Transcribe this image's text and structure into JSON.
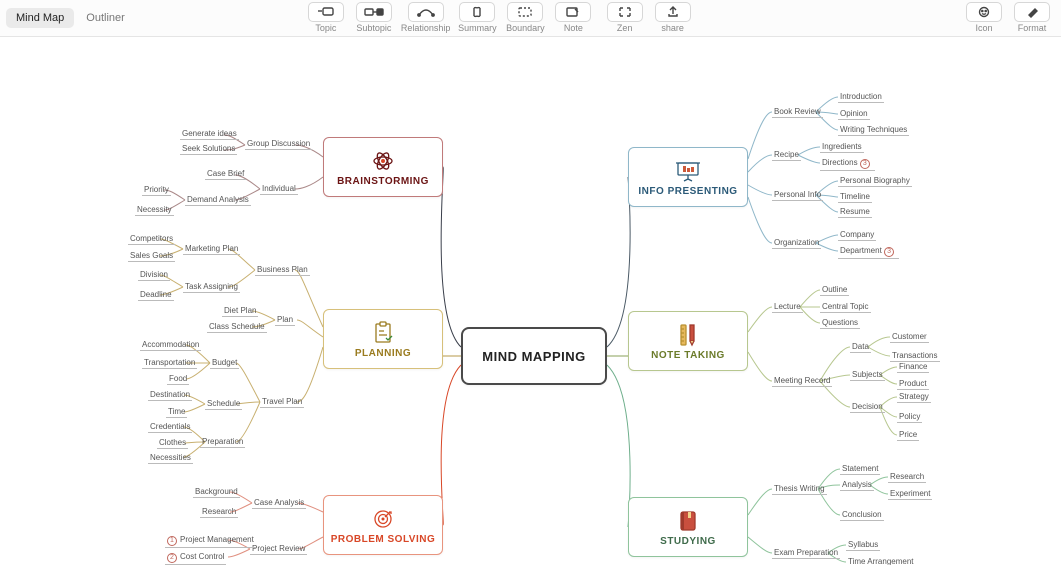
{
  "view_tabs": {
    "mindmap": "Mind Map",
    "outliner": "Outliner"
  },
  "tools": {
    "topic": "Topic",
    "subtopic": "Subtopic",
    "relationship": "Relationship",
    "summary": "Summary",
    "boundary": "Boundary",
    "note": "Note",
    "zen": "Zen",
    "share": "share",
    "icon": "Icon",
    "format": "Format"
  },
  "central": "MIND MAPPING",
  "mains": {
    "brain": "BRAINSTORMING",
    "plan": "PLANNING",
    "prob": "PROBLEM SOLVING",
    "info": "INFO PRESENTING",
    "note": "NOTE TAKING",
    "study": "STUDYING"
  },
  "leaves": {
    "group_disc": "Group Discussion",
    "gen_ideas": "Generate ideas",
    "seek_sol": "Seek Solutions",
    "individual": "Individual",
    "case_brief": "Case Brief",
    "demand": "Demand Analysis",
    "priority": "Priority",
    "necessity": "Necessity",
    "biz_plan": "Business Plan",
    "mkt_plan": "Marketing Plan",
    "competitors": "Competitors",
    "sales_goals": "Sales Goals",
    "task_asg": "Task Assigning",
    "division": "Division",
    "deadline": "Deadline",
    "plan": "Plan",
    "diet": "Diet Plan",
    "class": "Class Schedule",
    "travel": "Travel Plan",
    "budget": "Budget",
    "accom": "Accommodation",
    "transport": "Transportation",
    "food": "Food",
    "schedule": "Schedule",
    "dest": "Destination",
    "time": "Time",
    "prep": "Preparation",
    "cred": "Credentials",
    "clothes": "Clothes",
    "necess": "Necessities",
    "case_an": "Case Analysis",
    "background": "Background",
    "research": "Research",
    "proj_rev": "Project Review",
    "proj_mgmt": "Project Management",
    "cost": "Cost Control",
    "book_rev": "Book Review",
    "intro": "Introduction",
    "opinion": "Opinion",
    "writing": "Writing Techniques",
    "recipe": "Recipe",
    "ingr": "Ingredients",
    "dir": "Directions",
    "pinfo": "Personal Info",
    "pbio": "Personal Biography",
    "timeline": "Timeline",
    "resume": "Resume",
    "org": "Organization",
    "company": "Company",
    "dept": "Department",
    "lecture": "Lecture",
    "outline": "Outline",
    "ctopic": "Central Topic",
    "questions": "Questions",
    "mrec": "Meeting Record",
    "data": "Data",
    "customer": "Customer",
    "trans": "Transactions",
    "subjects": "Subjects",
    "finance": "Finance",
    "product": "Product",
    "decision": "Decision",
    "strategy": "Strategy",
    "policy": "Policy",
    "price": "Price",
    "thesis": "Thesis Writing",
    "statement": "Statement",
    "analysis": "Analysis",
    "res2": "Research",
    "exp": "Experiment",
    "concl": "Conclusion",
    "exam": "Exam Preparation",
    "syllabus": "Syllabus",
    "timearr": "Time Arrangement",
    "b1": "1",
    "b2": "2",
    "b3": "3"
  }
}
